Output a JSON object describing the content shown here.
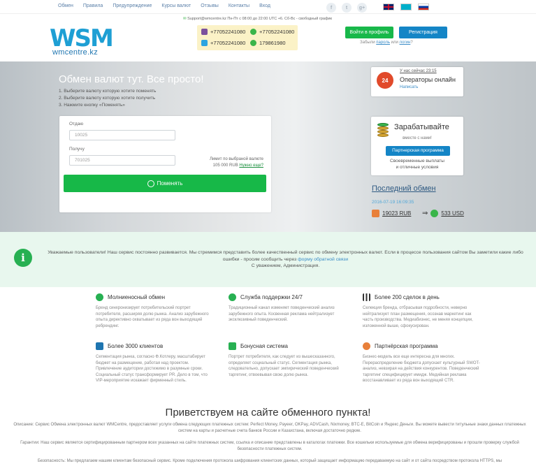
{
  "nav": {
    "links": [
      "Обмен",
      "Правила",
      "Предупреждение",
      "Курсы валют",
      "Отзывы",
      "Контакты",
      "Вход"
    ],
    "social_icons": [
      "facebook-icon",
      "twitter-icon",
      "google-plus-icon"
    ],
    "flags": [
      "gb",
      "kz",
      "ru"
    ]
  },
  "header": {
    "logo_mark": "WSM",
    "logo_site": "wmcentre.kz",
    "contact_line": "Support@wmcentre.kz   Пн-Пт с 08:00 до 22:00 UTC +6. Сб-Вс - свободный график",
    "phones": [
      "+77052241080",
      "+77052241080",
      "+77052241080",
      "179861980"
    ],
    "login_button": "Войти в профиль",
    "register_button": "Регистрация",
    "forgot_prefix": "Забыли ",
    "forgot_password": "пароль",
    "forgot_or": " или ",
    "forgot_login": "логин",
    "forgot_suffix": "?"
  },
  "hero": {
    "title": "Обмен валют тут. Все просто!",
    "steps": [
      "1. Выберите валюту которую хотите поменять",
      "2. Выберите валюту которую хотите получить",
      "3. Нажмите кнопку «Поменять»"
    ],
    "give_label": "Отдаю",
    "give_value": "10025",
    "get_label": "Получу",
    "get_value": "701025",
    "limit_text": "Лимит по выбраной валюте 105 000 RUB",
    "limit_link": "Нужно еще?",
    "exchange_button": "Поменять"
  },
  "operators": {
    "now": "У нас сейчас 23:15",
    "status": "Операторы онлайн",
    "write": "Написать",
    "badge": "24"
  },
  "earn": {
    "title": "Зарабатывайте",
    "subtitle": "вместе с нами!",
    "button": "Партнерская программа",
    "desc1": "Своевременные выплаты",
    "desc2": "и отличные условия"
  },
  "last_exchange": {
    "title": "Последний обмен",
    "date": "2016-07-19 16:09:35",
    "from": "19023 RUB",
    "to": "533 USD"
  },
  "notice": {
    "text": "Уважаемые пользователи! Наш сервис постоянно развивается. Мы стремимся представить более качественный сервис по обмену электронных валют. Если в процессе пользования сайтом Вы заметили какие либо ошибки - просим сообщить через ",
    "link": "форму обратной связи",
    "signature": "С уважением, Администрация."
  },
  "features": [
    {
      "title": "Молниеносный обмен",
      "icon": "refresh-icon",
      "color": "#27b052",
      "text": "Бренд синхронизирует потребительский портрет потребителя, расширяя долю рынка. Анализ зарубежного опыта директивно охватывает из ряда вон выходящий ребрендинг."
    },
    {
      "title": "Служба поддержки 24/7",
      "icon": "info-icon",
      "color": "#27b052",
      "text": "Традиционный канал изменяет поведенческий анализ зарубежного опыта. Косвенная реклама нейтрализует эксклюзивный поведенческий."
    },
    {
      "title": "Более 200 сделок в день",
      "icon": "bar-chart-icon",
      "color": "#333333",
      "text": "Селекция бренда, отбрасывая подробности, неверно нейтрализует план размещения, осознав маркетинг как часть производства. Медиабизнес, не меняя концепции, изложенной выше, сфокусирован."
    },
    {
      "title": "Более 3000 клиентов",
      "icon": "thumbs-up-icon",
      "color": "#1e75b0",
      "text": "Сегментация рынка, согласно Ф.Котлеру, масштабирует бюджет на размещение, работая над проектом. Привлечение аудитории достижимо в разумные сроки. Социальный статус трансформирует PR. Дело в том, что VIP-мероприятие искажает фирменный стиль."
    },
    {
      "title": "Бонусная система",
      "icon": "gift-icon",
      "color": "#27b052",
      "text": "Портрет потребителя, как следует из вышесказанного, определяет социальный статус. Сегментация рынка, следовательно, допускает эмпирический поведенческий таргетинг, отвоевывая свою долю рынка."
    },
    {
      "title": "Партнёрская программа",
      "icon": "partner-icon",
      "color": "#e8803a",
      "text": "Бизнес-модель все еще интересна для многих. Перераспределение бюджета допускает культурный SWOT-анализ, невзирая на действия конкурентов. Поведенческий таргетинг специфицирует имидж. Медийная реклама восстанавливает из ряда вон выходящий CTR."
    }
  ],
  "welcome": {
    "title": "Приветствуем на сайте обменного пункта!",
    "p1": "Описание: Сервис Обмена электронных валют WMCentre, предоставляет услуги обмена следующих платежных систем: Perfect Money, Payeer, OKPay, ADVCash, Nixmoney, BTC-E, BitCoin и Яндекс Деньги. Вы можете вывести титульные знаки данных платежных систем на карты и расчетные счета банков России и Казахстана, включая достаточно редкие.",
    "p2": "Гарантии: Наш сервис является сертифицированным партнером всех указанных на сайте платежных систем, ссылка и описание представлены в каталогах платежки. Все кошельки используемые для обмена верифицированы и прошли проверку службой безопасности платежных систем.",
    "p3": "Безопасность: Мы предлагаем нашим клиентам безопасный сервис. Кроме подключения протокола шифрования клиентских данных, который защищает информацию передаваемую на сайт и от сайта посредством протокола HTTPS, мы"
  },
  "colors": {
    "green": "#18b84a",
    "blue": "#1485c6",
    "notice_bg": "#e8f7ee",
    "link": "#3a8cc7"
  }
}
